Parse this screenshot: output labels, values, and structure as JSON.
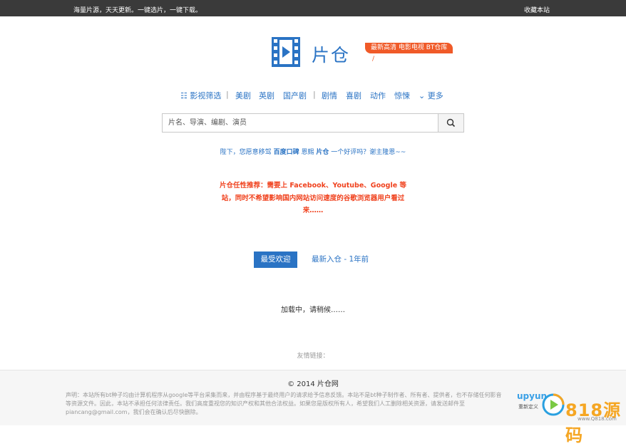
{
  "topbar": {
    "slogan": "海量片源，天天更新。一键选片，一键下载。",
    "favorite": "收藏本站"
  },
  "brand": {
    "name": "片仓",
    "tagline": "最新高清 电影电视 BT仓库",
    "tagline_tail": "/",
    "colors": {
      "primary": "#2a73c4",
      "accent": "#f05a28"
    }
  },
  "nav": {
    "filter": "影视筛选",
    "items": [
      "美剧",
      "英剧",
      "国产剧",
      "剧情",
      "喜剧",
      "动作",
      "惊悚"
    ],
    "more": "更多",
    "separator": "|"
  },
  "search": {
    "placeholder": "片名、导演、编剧、演员",
    "button_icon": "search-icon"
  },
  "notice": {
    "part1": "陛下，您愿意移驾",
    "bold1": "百度口碑",
    "part2": "恩赐",
    "bold2": "片仓",
    "part3": "一个好评吗？谢主隆恩~~"
  },
  "promo": {
    "text": "片仓任性推荐：需要上 Facebook、Youtube、Google 等站，同时不希望影响国内网站访问速度的谷歌浏览器用户看过来……"
  },
  "tabs": {
    "active": "最受欢迎",
    "other": "最新入仓 - 1年前"
  },
  "loading": "加载中，请稍候……",
  "friends": "友情链接：",
  "footer": {
    "copyright": "© 2014 片仓网",
    "disclaimer": "声明：本站所有bt种子均由计算机程序从google等平台采集而来，并由程序基于最终用户的请求给予信息反馈。本站不是bt种子制作者、所有者、提供者，也不存储任何影音等资源文件。因此，本站不承担任何法律责任。我们高度重视您的知识产权和其他合法权益。如果您是版权所有人，希望我们人工删除相关资源，请发送邮件至piancang@gmail.com，我们会在确认后尽快删除。"
  },
  "badges": {
    "upyun": "upyun",
    "upyun_sub": "重新定义",
    "watermark": "818源码",
    "watermark_url": "www.Q818.com"
  }
}
